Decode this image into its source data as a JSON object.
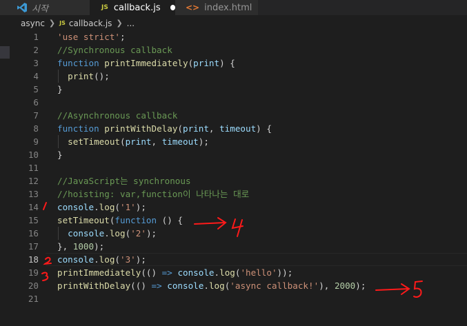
{
  "tabs": [
    {
      "label": "시작"
    },
    {
      "label": "callback.js"
    },
    {
      "label": "index.html"
    }
  ],
  "breadcrumb": {
    "folder": "async",
    "file": "callback.js",
    "more": "..."
  },
  "editor": {
    "current_line": 18,
    "lines": [
      {
        "n": "1",
        "parts": [
          [
            "str",
            "'use strict'"
          ],
          [
            "pun",
            ";"
          ]
        ]
      },
      {
        "n": "2",
        "parts": [
          [
            "com",
            "//Synchronous callback"
          ]
        ]
      },
      {
        "n": "3",
        "parts": [
          [
            "kw",
            "function "
          ],
          [
            "fn",
            "printImmediately"
          ],
          [
            "pun",
            "("
          ],
          [
            "var",
            "print"
          ],
          [
            "pun",
            ") {"
          ]
        ]
      },
      {
        "n": "4",
        "parts": [
          [
            "pun",
            "  "
          ],
          [
            "fn",
            "print"
          ],
          [
            "pun",
            "();"
          ]
        ]
      },
      {
        "n": "5",
        "parts": [
          [
            "pun",
            "}"
          ]
        ]
      },
      {
        "n": "6",
        "parts": []
      },
      {
        "n": "7",
        "parts": [
          [
            "com",
            "//Asynchronous callback"
          ]
        ]
      },
      {
        "n": "8",
        "parts": [
          [
            "kw",
            "function "
          ],
          [
            "fn",
            "printWithDelay"
          ],
          [
            "pun",
            "("
          ],
          [
            "var",
            "print"
          ],
          [
            "pun",
            ", "
          ],
          [
            "var",
            "timeout"
          ],
          [
            "pun",
            ") {"
          ]
        ]
      },
      {
        "n": "9",
        "parts": [
          [
            "pun",
            "  "
          ],
          [
            "fn",
            "setTimeout"
          ],
          [
            "pun",
            "("
          ],
          [
            "var",
            "print"
          ],
          [
            "pun",
            ", "
          ],
          [
            "var",
            "timeout"
          ],
          [
            "pun",
            ");"
          ]
        ]
      },
      {
        "n": "10",
        "parts": [
          [
            "pun",
            "}"
          ]
        ]
      },
      {
        "n": "11",
        "parts": []
      },
      {
        "n": "12",
        "parts": [
          [
            "com",
            "//JavaScript는 synchronous"
          ]
        ]
      },
      {
        "n": "13",
        "parts": [
          [
            "com",
            "//hoisting: var,function이 나타나는 대로"
          ]
        ]
      },
      {
        "n": "14",
        "parts": [
          [
            "var",
            "console"
          ],
          [
            "pun",
            "."
          ],
          [
            "fn",
            "log"
          ],
          [
            "pun",
            "("
          ],
          [
            "str",
            "'1'"
          ],
          [
            "pun",
            ");"
          ]
        ]
      },
      {
        "n": "15",
        "parts": [
          [
            "fn",
            "setTimeout"
          ],
          [
            "pun",
            "("
          ],
          [
            "kw",
            "function"
          ],
          [
            "pun",
            " () {"
          ]
        ]
      },
      {
        "n": "16",
        "parts": [
          [
            "pun",
            "  "
          ],
          [
            "var",
            "console"
          ],
          [
            "pun",
            "."
          ],
          [
            "fn",
            "log"
          ],
          [
            "pun",
            "("
          ],
          [
            "str",
            "'2'"
          ],
          [
            "pun",
            ");"
          ]
        ]
      },
      {
        "n": "17",
        "parts": [
          [
            "pun",
            "}, "
          ],
          [
            "num",
            "1000"
          ],
          [
            "pun",
            ");"
          ]
        ]
      },
      {
        "n": "18",
        "parts": [
          [
            "var",
            "console"
          ],
          [
            "pun",
            "."
          ],
          [
            "fn",
            "log"
          ],
          [
            "pun",
            "("
          ],
          [
            "str",
            "'3'"
          ],
          [
            "pun",
            ");"
          ]
        ]
      },
      {
        "n": "19",
        "parts": [
          [
            "fn",
            "printImmediately"
          ],
          [
            "pun",
            "(() "
          ],
          [
            "kw",
            "=>"
          ],
          [
            "pun",
            " "
          ],
          [
            "var",
            "console"
          ],
          [
            "pun",
            "."
          ],
          [
            "fn",
            "log"
          ],
          [
            "pun",
            "("
          ],
          [
            "str",
            "'hello'"
          ],
          [
            "pun",
            "));"
          ]
        ]
      },
      {
        "n": "20",
        "parts": [
          [
            "fn",
            "printWithDelay"
          ],
          [
            "pun",
            "(() "
          ],
          [
            "kw",
            "=>"
          ],
          [
            "pun",
            " "
          ],
          [
            "var",
            "console"
          ],
          [
            "pun",
            "."
          ],
          [
            "fn",
            "log"
          ],
          [
            "pun",
            "("
          ],
          [
            "str",
            "'async callback!'"
          ],
          [
            "pun",
            "), "
          ],
          [
            "num",
            "2000"
          ],
          [
            "pun",
            ");"
          ]
        ]
      },
      {
        "n": "21",
        "parts": []
      }
    ]
  },
  "annotations": {
    "mark_14": "/",
    "mark_18": "2",
    "mark_19": "3",
    "arrow_15_label": "4",
    "arrow_20_label": "5",
    "ink_color": "#ff1a1a"
  }
}
